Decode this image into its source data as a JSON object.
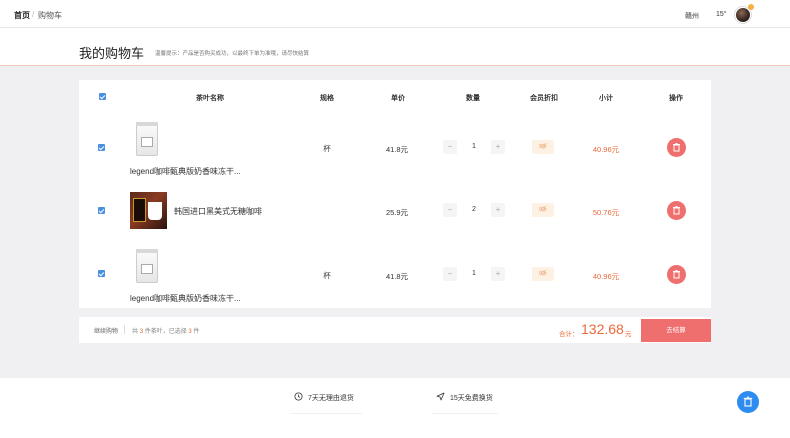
{
  "breadcrumb": {
    "home": "首页",
    "separator": "/",
    "current": "购物车"
  },
  "user": {
    "city": "赣州",
    "temperature": "15°"
  },
  "page": {
    "title": "我的购物车",
    "tip": "温馨提示：产品是否购买成功，以最终下单为准哦，请尽快结算"
  },
  "table": {
    "headers": [
      "茶叶名称",
      "规格",
      "单价",
      "数量",
      "会员折扣",
      "小计",
      "操作"
    ],
    "rows": [
      {
        "name": "legend咖啡甄典版奶香味冻干...",
        "thumb": "coffee-bag",
        "spec": "杯",
        "price": "41.8元",
        "qty": "1",
        "discount": "9折",
        "subtotal": "40.96元"
      },
      {
        "name": "韩国进口黑美式无糖咖啡",
        "thumb": "korean-coffee",
        "spec": "",
        "price": "25.9元",
        "qty": "2",
        "discount": "9折",
        "subtotal": "50.76元"
      },
      {
        "name": "legend咖啡甄典版奶香味冻干...",
        "thumb": "coffee-bag",
        "spec": "杯",
        "price": "41.8元",
        "qty": "1",
        "discount": "9折",
        "subtotal": "40.96元"
      }
    ],
    "qty_minus": "−",
    "qty_plus": "+"
  },
  "footer": {
    "continue": "继续购物",
    "summary_prefix": "共",
    "total_items": "3",
    "summary_mid": "件茶叶，已选择",
    "selected_items": "3",
    "summary_suffix": "件",
    "total_label": "合计：",
    "total_value": "132.68",
    "total_unit": "元",
    "checkout": "去结算"
  },
  "features": [
    {
      "icon": "clock-icon",
      "label": "7天无理由退货"
    },
    {
      "icon": "send-icon",
      "label": "15天免费换货"
    }
  ],
  "colors": {
    "accent": "#ef6f6f",
    "price": "#e86a3a",
    "checkbox": "#4a90e2",
    "fab": "#2d8cf0"
  }
}
